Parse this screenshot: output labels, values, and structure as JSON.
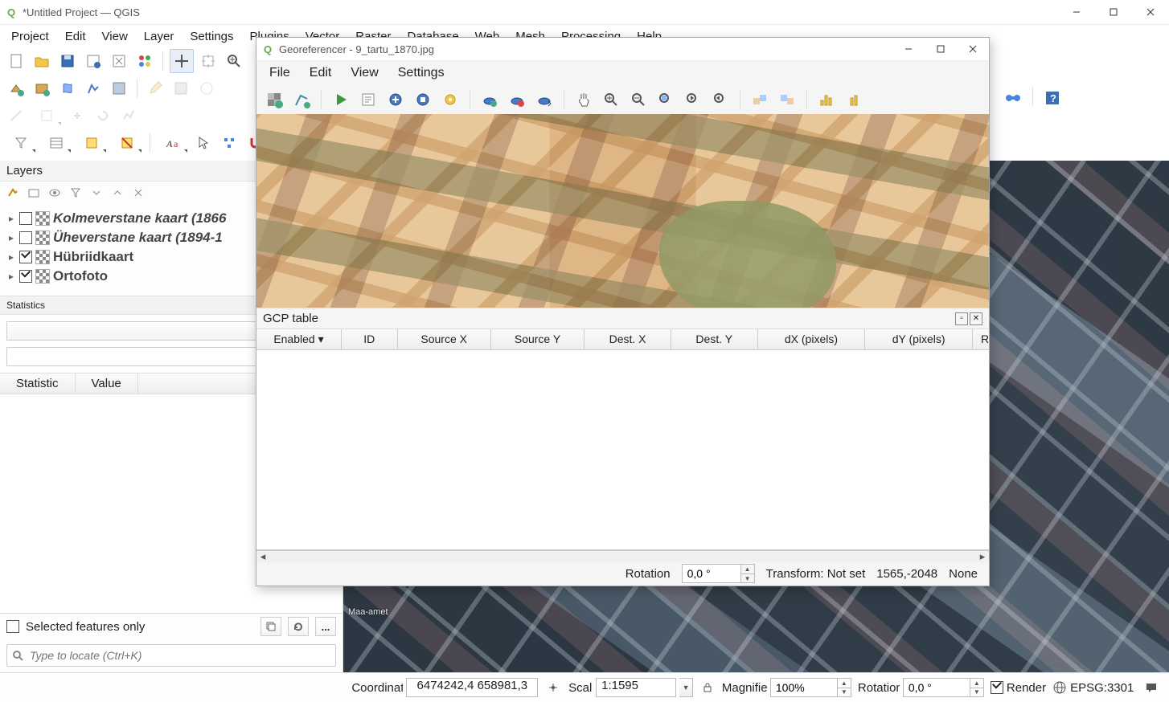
{
  "app": {
    "title": "*Untitled Project — QGIS"
  },
  "menu": {
    "project": "Project",
    "edit": "Edit",
    "view": "View",
    "layer": "Layer",
    "settings": "Settings",
    "plugins": "Plugins",
    "vector": "Vector",
    "raster": "Raster",
    "database": "Database",
    "web": "Web",
    "mesh": "Mesh",
    "processing": "Processing",
    "help": "Help"
  },
  "panels": {
    "layers_title": "Layers",
    "layers": [
      {
        "name": "Kolmeverstane kaart (1866",
        "checked": false,
        "italic": true
      },
      {
        "name": "Üheverstane kaart (1894-1",
        "checked": false,
        "italic": true
      },
      {
        "name": "Hübriidkaart",
        "checked": true,
        "italic": false
      },
      {
        "name": "Ortofoto",
        "checked": true,
        "italic": false
      }
    ],
    "stats_title": "Statistics",
    "stats_headers": {
      "stat": "Statistic",
      "value": "Value"
    },
    "selected_only": "Selected features only",
    "locator_placeholder": "Type to locate (Ctrl+K)",
    "dots_btn": "..."
  },
  "map": {
    "attribution": "Maa-amet"
  },
  "georef": {
    "title": "Georeferencer - 9_tartu_1870.jpg",
    "menu": {
      "file": "File",
      "edit": "Edit",
      "view": "View",
      "settings": "Settings"
    },
    "gcp_title": "GCP table",
    "columns": {
      "enabled": "Enabled",
      "id": "ID",
      "srcx": "Source X",
      "srcy": "Source Y",
      "dstx": "Dest. X",
      "dsty": "Dest. Y",
      "dxp": "dX (pixels)",
      "dyp": "dY (pixels)",
      "resid": "Resid"
    },
    "status": {
      "rotation_label": "Rotation",
      "rotation_value": "0,0 °",
      "transform": "Transform: Not set",
      "coords": "1565,-2048",
      "units": "None"
    }
  },
  "statusbar": {
    "coord_label": "Coordinate",
    "coord_value": "6474242,4 658981,3",
    "scale_label": "Scale",
    "scale_value": "1:1595",
    "magnifier_label": "Magnifier",
    "magnifier_value": "100%",
    "rotation_label": "Rotation",
    "rotation_value": "0,0 °",
    "render_label": "Render",
    "crs": "EPSG:3301"
  }
}
